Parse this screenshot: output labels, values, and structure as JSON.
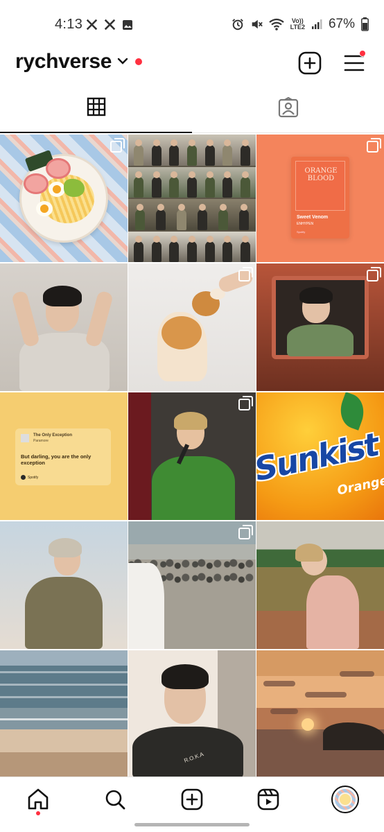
{
  "status_bar": {
    "time": "4:13",
    "lte_top": "Vo))",
    "lte_bottom": "LTE2",
    "battery": "67%"
  },
  "header": {
    "username": "rychverse",
    "accent_color": "#ff3040"
  },
  "tabs": [
    {
      "name": "grid",
      "icon": "grid-icon",
      "active": true
    },
    {
      "name": "tagged",
      "icon": "tagged-icon",
      "active": false
    }
  ],
  "posts": {
    "orange_blood": {
      "album_line1": "ORANGE",
      "album_line2": "BLOOD",
      "song": "Sweet Venom",
      "artist": "ENHYPEN",
      "service": "Spotify"
    },
    "quote": {
      "song": "The Only Exception",
      "artist": "Paramore",
      "lyric": "But darling, you are the only exception",
      "service": "Spotify"
    },
    "sunkist": {
      "brand": "Sunkist",
      "flavor": "Orange"
    },
    "selfie_shirt_text": "R.O.K.A"
  },
  "bottom_nav": [
    {
      "name": "home",
      "icon": "home-icon"
    },
    {
      "name": "search",
      "icon": "search-icon"
    },
    {
      "name": "create",
      "icon": "create-icon"
    },
    {
      "name": "reels",
      "icon": "reels-icon"
    },
    {
      "name": "profile",
      "icon": "avatar"
    }
  ]
}
